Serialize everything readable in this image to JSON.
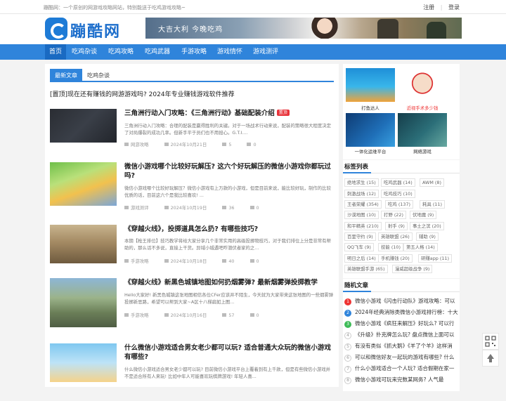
{
  "topbar": {
    "notice": "蹦酷网：一个原创的网游戏攻略网站，特别能送于吃鸡游戏攻略~",
    "login": "注册",
    "register": "登录"
  },
  "logo": {
    "text": "蹦酷网"
  },
  "banner": {
    "text": "大吉大利 今晚吃鸡"
  },
  "nav": [
    "首页",
    "吃鸡杂谈",
    "吃鸡攻略",
    "吃鸡武器",
    "手游攻略",
    "游戏情怀",
    "游戏测评"
  ],
  "tabs": [
    "最新文章",
    "吃鸡杂谈"
  ],
  "sticky": "[置顶]现在还有赚钱的网游游戏吗? 2024年专业赚钱游戏软件推荐",
  "articles": [
    {
      "title": "三角洲行动入门攻略：《三角洲行动》基础配装介绍",
      "hot": "置顶",
      "excerpt": "三角洲行动入门攻略：合理的配装是赢得胜利的关键。对于一场战术行动来说，配装的策略很大程度决定了对局爆裂的成功几率。但新手平于员们也不用担心。G.T.I....",
      "category": "网游攻略",
      "date": "2024年10月21日",
      "views": "5",
      "comments": "0"
    },
    {
      "title": "微信小游戏哪个比较好玩解压? 这六个好玩解压的微信小游戏你都玩过吗?",
      "excerpt": "微信小游戏哪个比较好玩解压？微信小游戏有上万款的小游戏，但是目前来说，能比较好玩，制作的比较优质的话，目前这六个是我比较喜欢! ...",
      "category": "游戏测评",
      "date": "2024年10月19日",
      "views": "36",
      "comments": "0"
    },
    {
      "title": "《穿越火线》，投掷道具怎么扔? 有哪些技巧?",
      "excerpt": "本期【枪王排位】技巧教学将给大家分享几个非常实用的高级投掷物技巧，对于我们排位上分是非常有帮助的，那么话不多说，直接上干货。异域小城遇吧咋潜伏者家的之...",
      "category": "手游攻略",
      "date": "2024年10月18日",
      "views": "40",
      "comments": "0"
    },
    {
      "title": "《穿越火线》新黑色城镇地图如何扔烟雾弹? 最新烟雾弹投掷教学",
      "excerpt": "Hello大家好! 新黑色城镇这张地图相信各位CFer应该并不陌生，今天就为大家带来这张地图的一些烟雾弹投掷新思路，希望可以帮到大家~A区十八梯扁如上图...",
      "category": "手游攻略",
      "date": "2024年10月16日",
      "views": "57",
      "comments": "0"
    },
    {
      "title": "什么微信小游戏适合男女老少都可以玩? 适合普通大众玩的微信小游戏有哪些?",
      "excerpt": "什么微信小游戏适合男女老少都可以玩? 目前微信小游戏平台上覆着到有上千款，但是有些微信小游戏并不是适合所有人来玩! 比如中年人可能喜欢玩棋牌游戏! 年轻人喜...",
      "category": "游戏测评",
      "date": "2024年10月15日",
      "views": "44",
      "comments": "0"
    }
  ],
  "ads": [
    {
      "caption": "打鱼达人"
    },
    {
      "caption": "近视手术多少钱"
    },
    {
      "caption": "一体化运维平台"
    },
    {
      "caption": "网络游戏"
    }
  ],
  "tags_title": "标签列表",
  "tags": [
    "绝地求生 (15)",
    "吃鸡武器 (14)",
    "AWM (8)",
    "刺激战场 (12)",
    "吃鸡技巧 (10)",
    "王者荣耀 (354)",
    "吃鸡 (137)",
    "耗具 (11)",
    "沙漠地图 (10)",
    "打野 (22)",
    "伏地魔 (9)",
    "和平精英 (210)",
    "射手 (9)",
    "事土之滨 (20)",
    "百里守约 (9)",
    "英雄联盟 (26)",
    "辅助 (9)",
    "QQ飞车 (9)",
    "技能 (10)",
    "第五人格 (14)",
    "明日之后 (14)",
    "手机赚钱 (20)",
    "研赚app (11)",
    "英雄联盟手游 (65)",
    "漫威超级战争 (9)"
  ],
  "random_title": "随机文章",
  "random": [
    "微信小游戏《闪击行动队》游戏攻略：可以",
    "2024年经典消除类微信小游戏排行榜：十大",
    "微信小游戏《疯狂来解压》好玩么? 可以行",
    "《升级》扑克牌怎么玩? 盘点微信上面可以",
    "有没有类似《抓大鹅》《羊了个羊》这样消",
    "可以和微信好友一起玩的游戏有哪些? 什么",
    "什么小游戏适合一个人玩? 适合假期在家一",
    "微信小游戏可玩来完数某网务? 人气最"
  ],
  "colors": {
    "accent": "#2f84db",
    "nav": "#2f84db",
    "hot": "#e8333a"
  }
}
